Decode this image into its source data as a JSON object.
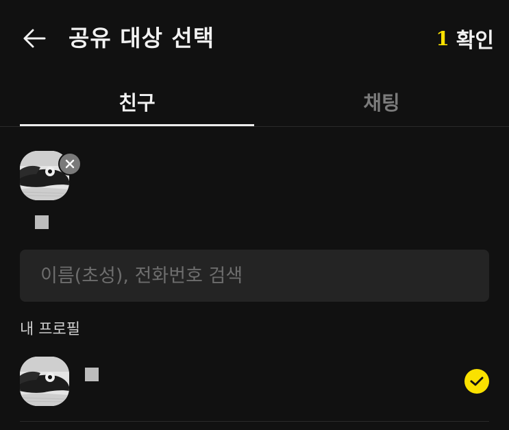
{
  "header": {
    "back_icon": "arrow-left-icon",
    "title": "공유 대상 선택",
    "confirm_count": "1",
    "confirm_label": "확인",
    "accent_color": "#fae100"
  },
  "tabs": [
    {
      "label": "친구",
      "selected": true
    },
    {
      "label": "채팅",
      "selected": false
    }
  ],
  "selected": [
    {
      "name": "■",
      "remove_icon": "close-icon"
    }
  ],
  "search": {
    "placeholder": "이름(초성), 전화번호 검색",
    "value": ""
  },
  "my_profile": {
    "section_label": "내 프로필",
    "name": "■",
    "checked": true,
    "check_icon": "check-icon"
  }
}
